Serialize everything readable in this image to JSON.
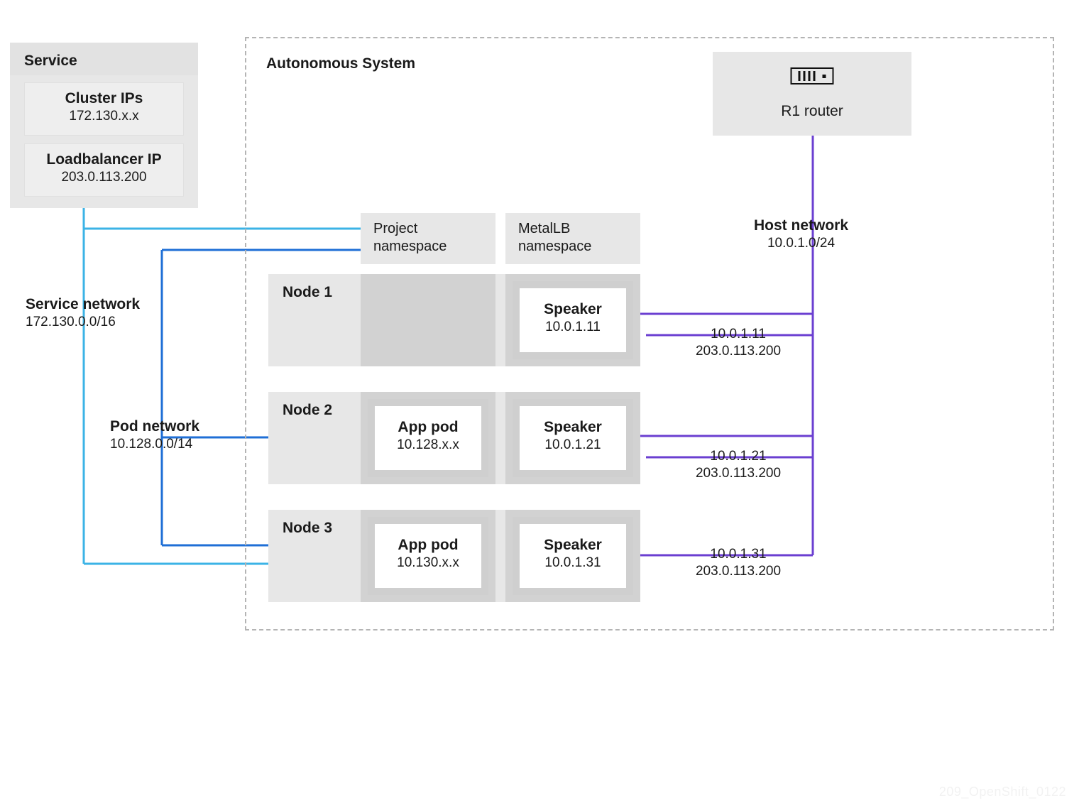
{
  "service": {
    "title": "Service",
    "cluster_ips": {
      "label": "Cluster IPs",
      "value": "172.130.x.x"
    },
    "lb_ip": {
      "label": "Loadbalancer IP",
      "value": "203.0.113.200"
    }
  },
  "networks": {
    "service": {
      "label": "Service network",
      "cidr": "172.130.0.0/16"
    },
    "pod": {
      "label": "Pod network",
      "cidr": "10.128.0.0/14"
    },
    "host": {
      "label": "Host network",
      "cidr": "10.0.1.0/24"
    }
  },
  "as_label": "Autonomous System",
  "namespaces": {
    "project": "Project namespace",
    "metallb": "MetalLB namespace"
  },
  "router": {
    "label": "R1 router"
  },
  "nodes": [
    {
      "name": "Node 1",
      "app_pod": null,
      "speaker": {
        "label": "Speaker",
        "ip": "10.0.1.11"
      },
      "bgp": {
        "ip": "10.0.1.11",
        "vip": "203.0.113.200"
      }
    },
    {
      "name": "Node 2",
      "app_pod": {
        "label": "App pod",
        "ip": "10.128.x.x"
      },
      "speaker": {
        "label": "Speaker",
        "ip": "10.0.1.21"
      },
      "bgp": {
        "ip": "10.0.1.21",
        "vip": "203.0.113.200"
      }
    },
    {
      "name": "Node 3",
      "app_pod": {
        "label": "App pod",
        "ip": "10.130.x.x"
      },
      "speaker": {
        "label": "Speaker",
        "ip": "10.0.1.31"
      },
      "bgp": {
        "ip": "10.0.1.31",
        "vip": "203.0.113.200"
      }
    }
  ],
  "watermark": "209_OpenShift_0122",
  "colors": {
    "light_blue": "#3bb3e6",
    "blue": "#1f6fd6",
    "purple": "#6b3fd1"
  }
}
